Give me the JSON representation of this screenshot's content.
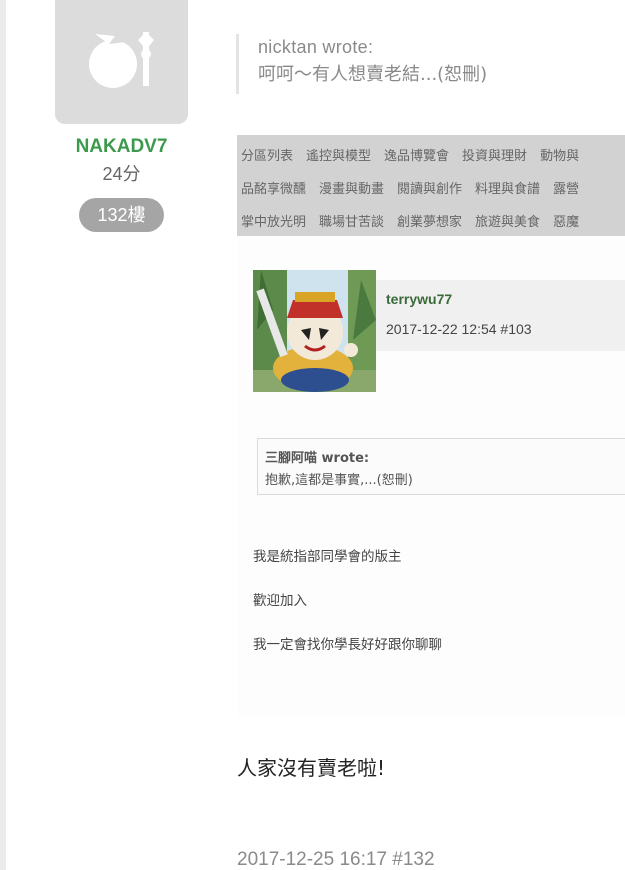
{
  "author": {
    "name": "NAKADV7",
    "score": "24分",
    "floor": "132樓"
  },
  "quote": {
    "author_line": "nicktan wrote:",
    "text": "呵呵～有人想賣老結...(恕刪)"
  },
  "screenshot": {
    "nav_rows": [
      [
        "分區列表",
        "遙控與模型",
        "逸品博覽會",
        "投資與理財",
        "動物與"
      ],
      [
        "品酩享微醺",
        "漫畫與動畫",
        "閱讀與創作",
        "料理與食譜",
        "露營"
      ],
      [
        "掌中放光明",
        "職場甘苦談",
        "創業夢想家",
        "旅遊與美食",
        "惡魔"
      ]
    ],
    "username": "terrywu77",
    "datetime": "2017-12-22 12:54  #103",
    "inner_quote": {
      "author_line": "三腳阿喵 wrote:",
      "text": "抱歉,這都是事實,...(恕刪)"
    },
    "lines": [
      "我是統指部同學會的版主",
      "歡迎加入",
      "我一定會找你學長好好跟你聊聊"
    ]
  },
  "reply": "人家沒有賣老啦!",
  "footer": "2017-12-25 16:17 #132",
  "colors": {
    "username": "#3d9a4d",
    "badge": "#a5a5a5",
    "nav_bg": "#d2d2d2"
  }
}
